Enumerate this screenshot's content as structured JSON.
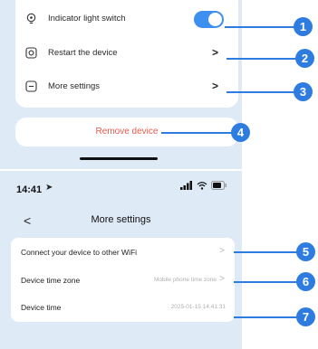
{
  "top_panel": {
    "rows": [
      {
        "label": "Indicator light switch",
        "icon": "bulb-icon",
        "control": "toggle",
        "toggle_on": true
      },
      {
        "label": "Restart the device",
        "icon": "restart-icon",
        "control": "chevron"
      },
      {
        "label": "More settings",
        "icon": "more-icon",
        "control": "chevron"
      }
    ],
    "chevron_glyph": ">",
    "remove_label": "Remove device"
  },
  "bottom_panel": {
    "status_time": "14:41",
    "nav_title": "More settings",
    "back_glyph": "<",
    "chevron_glyph": ">",
    "rows": [
      {
        "label": "Connect your device to other WiFi",
        "value": ""
      },
      {
        "label": "Device time zone",
        "value": "Mobile phone time zone"
      },
      {
        "label": "Device time",
        "value": "2025-01-15 14:41:31"
      }
    ]
  },
  "callouts": [
    "1",
    "2",
    "3",
    "4",
    "5",
    "6",
    "7"
  ],
  "colors": {
    "accent": "#2f7ce0",
    "toggle": "#3d8ff0",
    "panel_bg": "#dfeaf7",
    "danger": "#e85a4f"
  }
}
